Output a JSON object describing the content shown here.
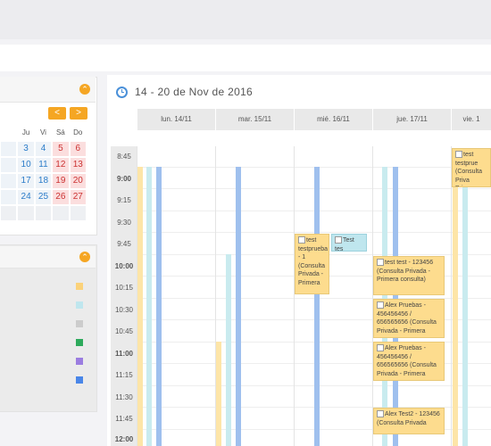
{
  "date_range": "14 - 20 de Nov de 2016",
  "mini_calendar": {
    "prev_label": "<",
    "next_label": ">",
    "weekdays": [
      "",
      "Ju",
      "Vi",
      "Sá",
      "Do"
    ],
    "weeks": [
      [
        "",
        "3",
        "4",
        "5",
        "6"
      ],
      [
        "",
        "10",
        "11",
        "12",
        "13"
      ],
      [
        "",
        "17",
        "18",
        "19",
        "20"
      ],
      [
        "",
        "24",
        "25",
        "26",
        "27"
      ],
      [
        "",
        "",
        "",
        "",
        ""
      ]
    ]
  },
  "legend": {
    "colors": [
      "#fbd27a",
      "#bfe6ee",
      "#cccccc",
      "#2eaa5c",
      "#9b7de0",
      "#4a86e8"
    ]
  },
  "days": [
    "lun. 14/11",
    "mar. 15/11",
    "mié. 16/11",
    "jue. 17/11",
    "vie. 1"
  ],
  "times": [
    {
      "label": "8:45",
      "hour": false
    },
    {
      "label": "9:00",
      "hour": true
    },
    {
      "label": "9:15",
      "hour": false
    },
    {
      "label": "9:30",
      "hour": false
    },
    {
      "label": "9:45",
      "hour": false
    },
    {
      "label": "10:00",
      "hour": true
    },
    {
      "label": "10:15",
      "hour": false
    },
    {
      "label": "10:30",
      "hour": false
    },
    {
      "label": "10:45",
      "hour": false
    },
    {
      "label": "11:00",
      "hour": true
    },
    {
      "label": "11:15",
      "hour": false
    },
    {
      "label": "11:30",
      "hour": false
    },
    {
      "label": "11:45",
      "hour": false
    },
    {
      "label": "12:00",
      "hour": true
    }
  ],
  "events": {
    "e1": "test testprueba - 1 (Consulta Privada - Primera",
    "e2": "Test tes",
    "e3": "test test - 123456 (Consulta Privada - Primera consulta)",
    "e4": "Alex Pruebas - 456456456 / 656565656 (Consulta Privada - Primera",
    "e5": "Alex Pruebas - 456456456 / 656565656 (Consulta Privada - Primera",
    "e6": "Alex Test2 - 123456 (Consulta Privada",
    "e7": "test testprue (Consulta Priva Primera consu"
  }
}
